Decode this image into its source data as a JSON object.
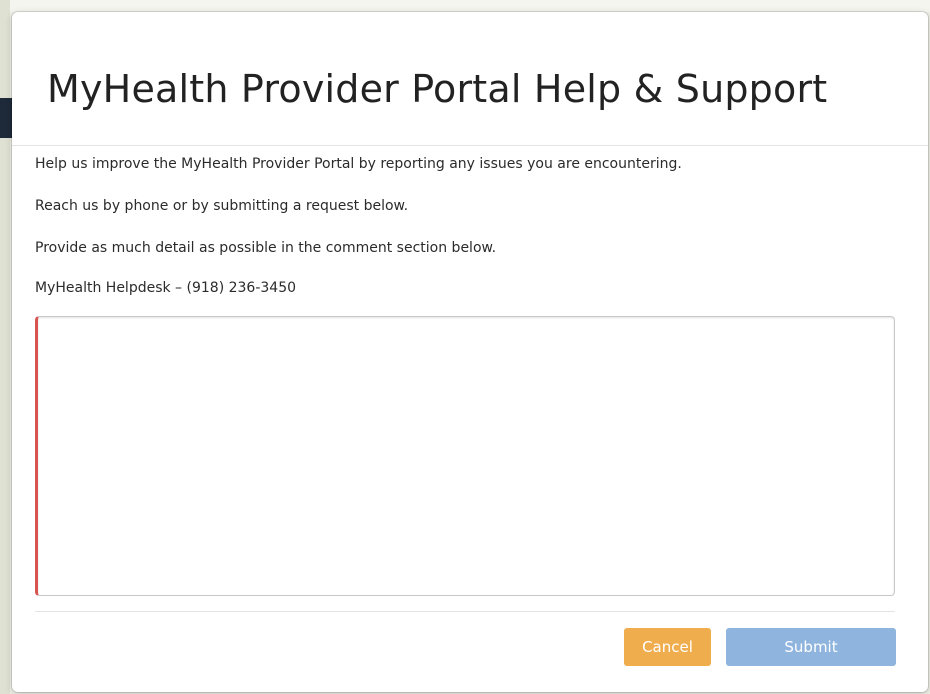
{
  "modal": {
    "title": "MyHealth Provider Portal Help & Support",
    "body_lines": [
      "Help us improve the MyHealth Provider Portal by reporting any issues you are encountering.",
      "Reach us by phone or by submitting a request below.",
      "Provide as much detail as possible in the comment section below.",
      "MyHealth Helpdesk – (918) 236-3450"
    ],
    "comment": {
      "value": "",
      "placeholder": ""
    },
    "buttons": {
      "cancel_label": "Cancel",
      "submit_label": "Submit"
    }
  },
  "colors": {
    "cancel_button": "#f0ad4e",
    "submit_button": "#8fb5df",
    "comment_required_border": "#d9534f"
  }
}
